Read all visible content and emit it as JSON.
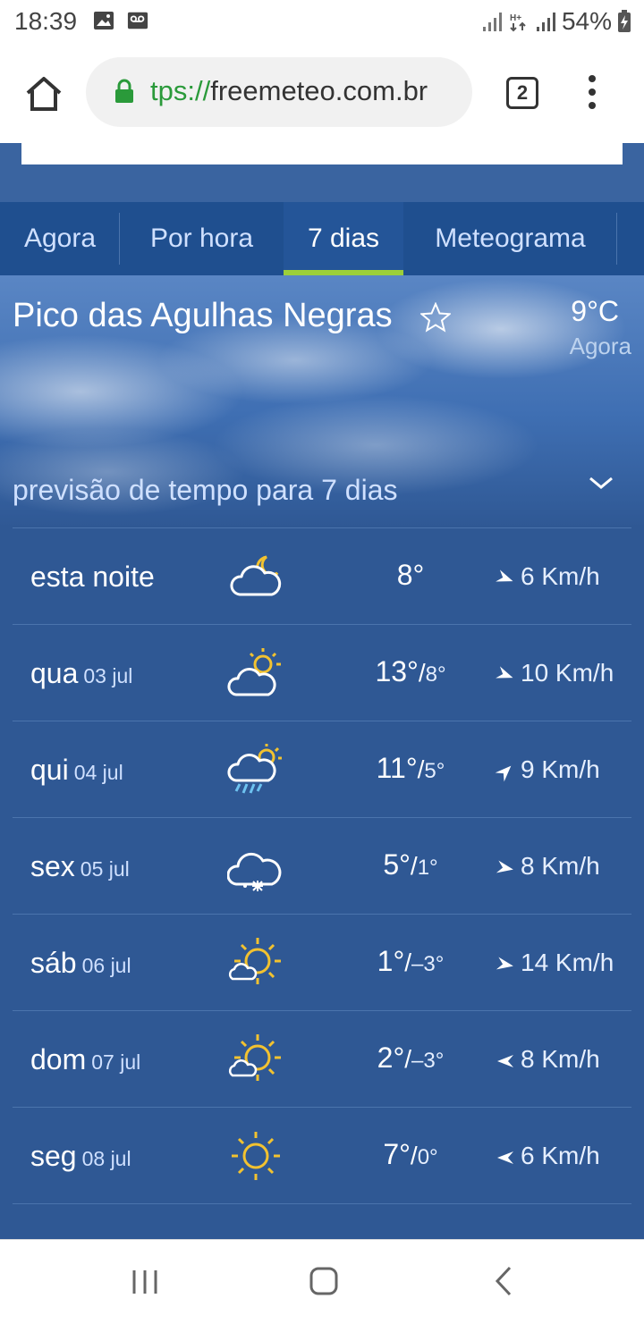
{
  "status_bar": {
    "time": "18:39",
    "battery": "54%"
  },
  "browser": {
    "url_scheme": "tps://",
    "url_host": "freemeteo.com.br",
    "tab_count": "2"
  },
  "nav_tabs": [
    {
      "label": "Agora",
      "active": false
    },
    {
      "label": "Por hora",
      "active": false
    },
    {
      "label": "7 dias",
      "active": true
    },
    {
      "label": "Meteograma",
      "active": false
    }
  ],
  "hero": {
    "location": "Pico das Agulhas Negras",
    "current_temp": "9°C",
    "current_label": "Agora",
    "forecast_title": "previsão de tempo para 7 dias"
  },
  "forecast": [
    {
      "day": "esta noite",
      "date": "",
      "icon": "partly-cloudy-night-icon",
      "max": "8°",
      "min": "",
      "wind": "6 Km/h"
    },
    {
      "day": "qua",
      "date": "03 jul",
      "icon": "partly-cloudy-day-icon",
      "max": "13°",
      "min": "8°",
      "wind": "10 Km/h"
    },
    {
      "day": "qui",
      "date": "04 jul",
      "icon": "rain-sun-icon",
      "max": "11°",
      "min": "5°",
      "wind": "9 Km/h"
    },
    {
      "day": "sex",
      "date": "05 jul",
      "icon": "snow-cloud-icon",
      "max": "5°",
      "min": "1°",
      "wind": "8 Km/h"
    },
    {
      "day": "sáb",
      "date": "06 jul",
      "icon": "sun-small-cloud-icon",
      "max": "1°",
      "min": "–3°",
      "wind": "14 Km/h"
    },
    {
      "day": "dom",
      "date": "07 jul",
      "icon": "sun-small-cloud-icon",
      "max": "2°",
      "min": "–3°",
      "wind": "8 Km/h"
    },
    {
      "day": "seg",
      "date": "08 jul",
      "icon": "sun-icon",
      "max": "7°",
      "min": "0°",
      "wind": "6 Km/h"
    }
  ],
  "colors": {
    "background": "#2f5894",
    "active_tab_underline": "#9ccf3a",
    "sun": "#f2c230"
  }
}
